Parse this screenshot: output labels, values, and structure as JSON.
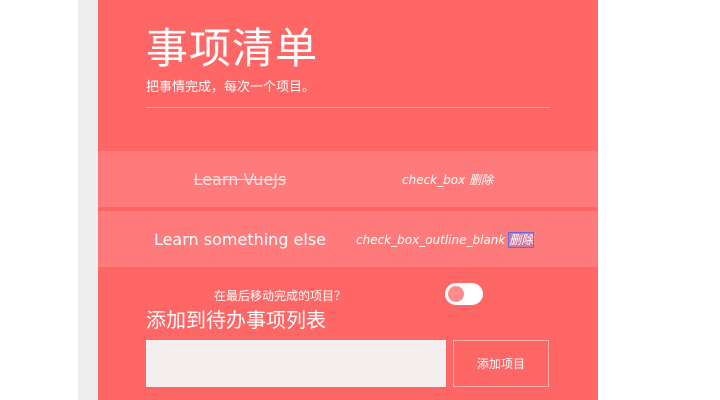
{
  "header": {
    "title": "事项清单",
    "subtitle": "把事情完成，每次一个项目。"
  },
  "todos": [
    {
      "label": "Learn VueJs",
      "completed": true,
      "status_icon": "check_box",
      "delete_label": "删除"
    },
    {
      "label": "Learn something else",
      "completed": false,
      "status_icon": "check_box_outline_blank",
      "delete_label": "删除"
    }
  ],
  "settings": {
    "move_completed_label": "在最后移动完成的项目？",
    "move_completed_on": false
  },
  "add_form": {
    "title": "添加到待办事项列表",
    "input_value": "",
    "button_label": "添加项目"
  },
  "colors": {
    "panel": "#ff6666",
    "item": "#ff7b7b",
    "input": "#f5eeee"
  }
}
